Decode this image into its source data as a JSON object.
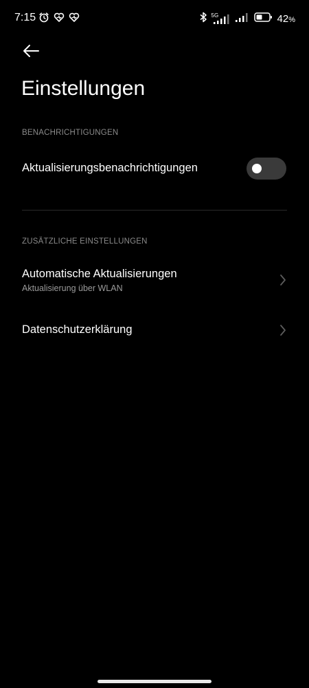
{
  "status_bar": {
    "time": "7:15",
    "battery_value": "42",
    "battery_unit": "%",
    "network_label": "5G",
    "left_icons": [
      "alarm-icon",
      "heart-notification-icon",
      "heart-notification-icon"
    ],
    "right_icons": [
      "bluetooth-icon",
      "signal-5g-icon",
      "signal-icon",
      "battery-icon"
    ]
  },
  "header": {
    "back_icon": "arrow-left-icon",
    "title": "Einstellungen"
  },
  "sections": [
    {
      "header": "BENACHRICHTIGUNGEN",
      "items": [
        {
          "title": "Aktualisierungsbenachrichtigungen",
          "toggle_on": false
        }
      ]
    },
    {
      "header": "ZUSÄTZLICHE EINSTELLUNGEN",
      "items": [
        {
          "title": "Automatische Aktualisierungen",
          "subtitle": "Aktualisierung über WLAN",
          "icon": "chevron-right-icon"
        },
        {
          "title": "Datenschutzerklärung",
          "icon": "chevron-right-icon"
        }
      ]
    }
  ],
  "colors": {
    "background": "#000000",
    "text_primary": "#ffffff",
    "text_secondary": "#8a8a8a",
    "toggle_track_off": "#3a3a3a"
  }
}
